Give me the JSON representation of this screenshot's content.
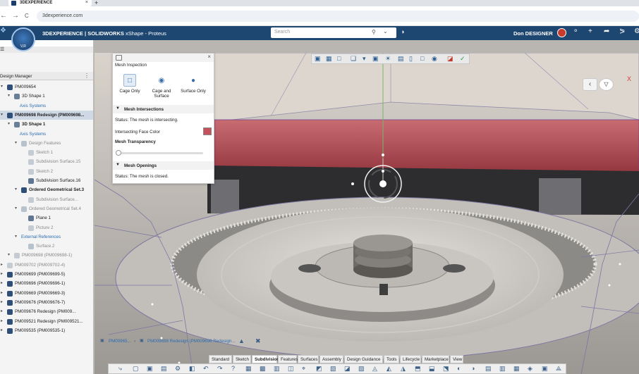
{
  "browser": {
    "tab_title": "3DEXPERIENCE",
    "tab_close": "×",
    "new_tab": "+",
    "back": "←",
    "forward": "→",
    "reload": "C",
    "url": "3dexperience.com"
  },
  "header": {
    "compass_label": "V,R",
    "brand_bold": "3DEXPERIENCE | SOLIDWORKS",
    "brand_app": "xShape - Proteus",
    "search_placeholder": "Search",
    "user_name": "Don DESIGNER",
    "brand_color": "#1d4671"
  },
  "left_panel": {
    "title": "Design Manager",
    "menu_glyph": "⋮",
    "tree": [
      {
        "label": "PM009654",
        "state": "normal"
      },
      {
        "label": "3D Shape 1",
        "state": "normal"
      },
      {
        "label": "Axis Systems",
        "state": "blue"
      },
      {
        "label": "PM009698 Redesign (PM009698...",
        "state": "selected"
      },
      {
        "label": "3D Shape 1",
        "state": "bold"
      },
      {
        "label": "Axis Systems",
        "state": "blue"
      },
      {
        "label": "Design Features",
        "state": "dim"
      },
      {
        "label": "Sketch 1",
        "state": "dim"
      },
      {
        "label": "Subdivision Surface.15",
        "state": "dim"
      },
      {
        "label": "Sketch 2",
        "state": "dim"
      },
      {
        "label": "Subdivision Surface.16",
        "state": "normal"
      },
      {
        "label": "Ordered Geometrical Set.3",
        "state": "bold"
      },
      {
        "label": "Subdivision Surface...",
        "state": "dim"
      },
      {
        "label": "Ordered Geometrical Set.4",
        "state": "dim"
      },
      {
        "label": "Plane 1",
        "state": "normal"
      },
      {
        "label": "Picture 2",
        "state": "dim"
      },
      {
        "label": "External References",
        "state": "blue"
      },
      {
        "label": "Surface.2",
        "state": "dim"
      },
      {
        "label": "PM009698 (PM009698-1)",
        "state": "dim"
      },
      {
        "label": "PM009702 (PM009702-4)",
        "state": "dim"
      },
      {
        "label": "PM009699 (PM009699-5)",
        "state": "normal"
      },
      {
        "label": "PM009696 (PM009696-1)",
        "state": "normal"
      },
      {
        "label": "PM009669 (PM009669-3)",
        "state": "normal"
      },
      {
        "label": "PM009676 (PM009676-7)",
        "state": "normal"
      },
      {
        "label": "PM009676 Redesign (PM009...",
        "state": "normal"
      },
      {
        "label": "PM009521 Redesign (PM009521...",
        "state": "normal"
      },
      {
        "label": "PM009535 (PM009535-1)",
        "state": "normal"
      }
    ]
  },
  "mesh_panel": {
    "title": "Mesh Inspection",
    "close": "×",
    "options": [
      {
        "label": "Cage Only",
        "active": true
      },
      {
        "label": "Cage and Surface",
        "active": false
      },
      {
        "label": "Surface Only",
        "active": false
      }
    ],
    "intersections": {
      "heading": "Mesh Intersections",
      "status": "Status: The mesh is intersecting.",
      "color_label": "Intersecting Face Color",
      "color": "#c6505c"
    },
    "transparency": {
      "heading": "Mesh Transparency",
      "level": 0
    },
    "openings": {
      "heading": "Mesh Openings",
      "status": "Status: The mesh is closed."
    }
  },
  "viewport": {
    "x_axis_label": "X",
    "back_glyph": "‹"
  },
  "breadcrumb": {
    "root": "PM00965...",
    "current": "PM009698 Redesign (PM009698 Redesign..."
  },
  "bottom_tabs": [
    "Standard",
    "Sketch",
    "Subdivision",
    "Features",
    "Surfaces",
    "Assembly",
    "Design Guidance",
    "Tools",
    "Lifecycle",
    "Marketplace",
    "View"
  ],
  "active_tab": "Subdivision"
}
